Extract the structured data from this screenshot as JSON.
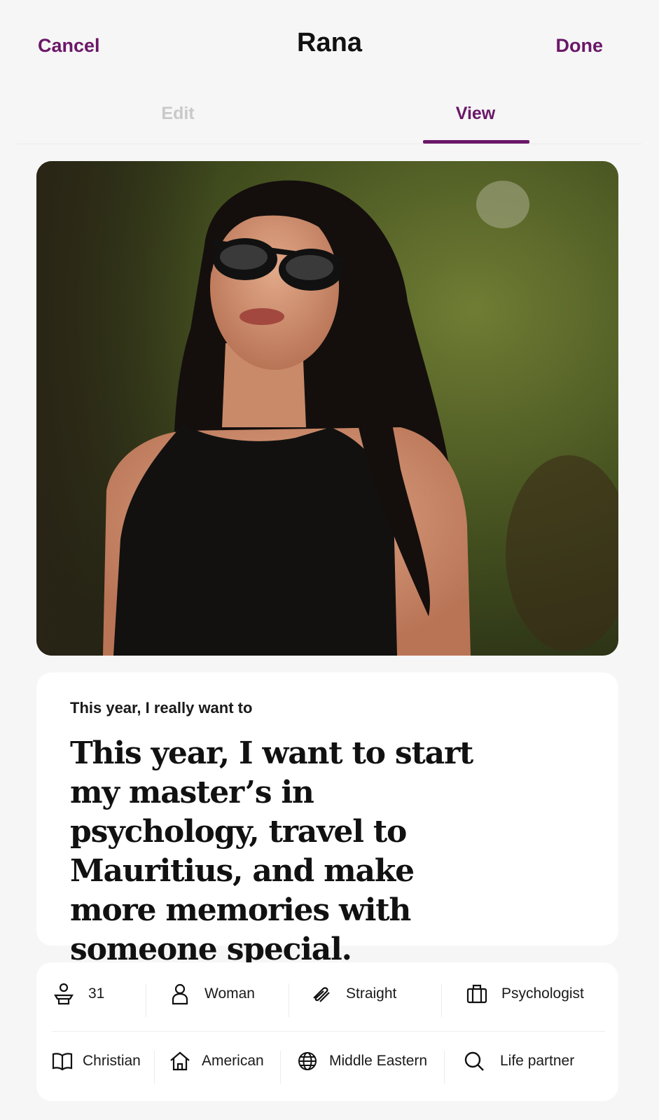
{
  "header": {
    "cancel_label": "Cancel",
    "title": "Rana",
    "done_label": "Done"
  },
  "tabs": [
    {
      "label": "Edit",
      "active": false
    },
    {
      "label": "View",
      "active": true
    }
  ],
  "accent_color": "#6b1768",
  "prompt": {
    "label": "This year, I really want to",
    "answer": "This year, I want to start my master’s in psychology, travel to Mauritius, and make more memories with someone special."
  },
  "info": {
    "row1": [
      {
        "icon": "age-icon",
        "text": "31"
      },
      {
        "icon": "person-icon",
        "text": "Woman"
      },
      {
        "icon": "orientation-icon",
        "text": "Straight"
      },
      {
        "icon": "briefcase-icon",
        "text": "Psychologist"
      }
    ],
    "row2": [
      {
        "icon": "book-icon",
        "text": "Christian"
      },
      {
        "icon": "home-icon",
        "text": "American"
      },
      {
        "icon": "globe-icon",
        "text": "Middle Eastern"
      },
      {
        "icon": "search-icon",
        "text": "Life partner"
      }
    ]
  }
}
